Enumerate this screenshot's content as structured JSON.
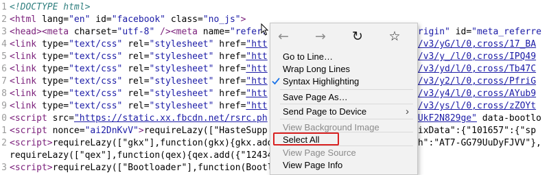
{
  "source_lines": [
    {
      "n": "1",
      "segments": [
        {
          "cls": "c",
          "text": "<!DOCTYPE html>"
        }
      ]
    },
    {
      "n": "2",
      "segments": [
        {
          "cls": "t",
          "text": "<html "
        },
        {
          "cls": "a",
          "text": "lang="
        },
        {
          "cls": "v",
          "text": "\"en\""
        },
        {
          "cls": "a",
          "text": " id="
        },
        {
          "cls": "v",
          "text": "\"facebook\""
        },
        {
          "cls": "a",
          "text": " class="
        },
        {
          "cls": "v",
          "text": "\"no_js\""
        },
        {
          "cls": "t",
          "text": ">"
        }
      ]
    },
    {
      "n": "3",
      "segments": [
        {
          "cls": "t",
          "text": "<head><meta "
        },
        {
          "cls": "a",
          "text": "charset="
        },
        {
          "cls": "v",
          "text": "\"utf-8\""
        },
        {
          "cls": "t",
          "text": " /><meta "
        },
        {
          "cls": "a",
          "text": "name="
        },
        {
          "cls": "v",
          "text": "\"referr"
        },
        {
          "cls": "plain",
          "text": "                         "
        },
        {
          "cls": "v",
          "text": "ssorigin\""
        },
        {
          "cls": "a",
          "text": " id="
        },
        {
          "cls": "v",
          "text": "\"meta_referre"
        }
      ]
    },
    {
      "n": "4",
      "segments": [
        {
          "cls": "t",
          "text": "<link "
        },
        {
          "cls": "a",
          "text": "type="
        },
        {
          "cls": "v",
          "text": "\"text/css\""
        },
        {
          "cls": "a",
          "text": " rel="
        },
        {
          "cls": "v",
          "text": "\"stylesheet\""
        },
        {
          "cls": "a",
          "text": " href="
        },
        {
          "cls": "lnk",
          "text": "\"htt"
        },
        {
          "cls": "plain",
          "text": "                         "
        },
        {
          "cls": "lnk",
          "text": "php/v3/yG/l/0,cross/17_BA"
        }
      ]
    },
    {
      "n": "5",
      "segments": [
        {
          "cls": "t",
          "text": "<link "
        },
        {
          "cls": "a",
          "text": "type="
        },
        {
          "cls": "v",
          "text": "\"text/css\""
        },
        {
          "cls": "a",
          "text": " rel="
        },
        {
          "cls": "v",
          "text": "\"stylesheet\""
        },
        {
          "cls": "a",
          "text": " href="
        },
        {
          "cls": "lnk",
          "text": "\"htt"
        },
        {
          "cls": "plain",
          "text": "                         "
        },
        {
          "cls": "lnk",
          "text": "php/v3/y_/l/0,cross/IPQ49"
        }
      ]
    },
    {
      "n": "6",
      "segments": [
        {
          "cls": "t",
          "text": "<link "
        },
        {
          "cls": "a",
          "text": "type="
        },
        {
          "cls": "v",
          "text": "\"text/css\""
        },
        {
          "cls": "a",
          "text": " rel="
        },
        {
          "cls": "v",
          "text": "\"stylesheet\""
        },
        {
          "cls": "a",
          "text": " href="
        },
        {
          "cls": "lnk",
          "text": "\"htt"
        },
        {
          "cls": "plain",
          "text": "                         "
        },
        {
          "cls": "lnk",
          "text": "php/v3/yd/l/0,cross/Tb47C"
        }
      ]
    },
    {
      "n": "7",
      "segments": [
        {
          "cls": "t",
          "text": "<link "
        },
        {
          "cls": "a",
          "text": "type="
        },
        {
          "cls": "v",
          "text": "\"text/css\""
        },
        {
          "cls": "a",
          "text": " rel="
        },
        {
          "cls": "v",
          "text": "\"stylesheet\""
        },
        {
          "cls": "a",
          "text": " href="
        },
        {
          "cls": "lnk",
          "text": "\"htt"
        },
        {
          "cls": "plain",
          "text": "                         "
        },
        {
          "cls": "lnk",
          "text": "php/v3/y2/l/0,cross/PfriG"
        }
      ]
    },
    {
      "n": "8",
      "segments": [
        {
          "cls": "t",
          "text": "<link "
        },
        {
          "cls": "a",
          "text": "type="
        },
        {
          "cls": "v",
          "text": "\"text/css\""
        },
        {
          "cls": "a",
          "text": " rel="
        },
        {
          "cls": "v",
          "text": "\"stylesheet\""
        },
        {
          "cls": "a",
          "text": " href="
        },
        {
          "cls": "lnk",
          "text": "\"htt"
        },
        {
          "cls": "plain",
          "text": "                         "
        },
        {
          "cls": "lnk",
          "text": "php/v3/y4/l/0,cross/AYub9"
        }
      ]
    },
    {
      "n": "9",
      "segments": [
        {
          "cls": "t",
          "text": "<link "
        },
        {
          "cls": "a",
          "text": "type="
        },
        {
          "cls": "v",
          "text": "\"text/css\""
        },
        {
          "cls": "a",
          "text": " rel="
        },
        {
          "cls": "v",
          "text": "\"stylesheet\""
        },
        {
          "cls": "a",
          "text": " href="
        },
        {
          "cls": "lnk",
          "text": "\"htt"
        },
        {
          "cls": "plain",
          "text": "                         "
        },
        {
          "cls": "lnk",
          "text": "php/v3/ys/l/0,cross/zZOYt"
        }
      ]
    },
    {
      "n": "0",
      "segments": [
        {
          "cls": "t",
          "text": "<script "
        },
        {
          "cls": "a",
          "text": "src="
        },
        {
          "cls": "lnk",
          "text": "\"https://static.xx.fbcdn.net/rsrc.ph"
        },
        {
          "cls": "plain",
          "text": "                         "
        },
        {
          "cls": "lnk",
          "text": "k=dUkF2N829ge\""
        },
        {
          "cls": "a",
          "text": " data-bootlo"
        }
      ]
    },
    {
      "n": "1",
      "segments": [
        {
          "cls": "t",
          "text": "<script "
        },
        {
          "cls": "a",
          "text": "nonce="
        },
        {
          "cls": "v",
          "text": "\"ai2DnKvV\""
        },
        {
          "cls": "t",
          "text": ">"
        },
        {
          "cls": "plain",
          "text": "requireLazy([\"HasteSupp                         ({\"ixData\":{\"101657\":{\"sp"
        }
      ]
    },
    {
      "n": "2",
      "segments": [
        {
          "cls": "t",
          "text": "<script>"
        },
        {
          "cls": "plain",
          "text": "requireLazy([\"gkx\"],function(gkx){gkx.add                         ash\":\"AT7-GG79UuDyFJVV\"},"
        }
      ]
    },
    {
      "n": "",
      "segments": [
        {
          "cls": "plain",
          "text": "requireLazy([\"qex\"],function(qex){qex.add({\"12434"
        }
      ]
    },
    {
      "n": "3",
      "segments": [
        {
          "cls": "t",
          "text": "<script>"
        },
        {
          "cls": "plain",
          "text": "requireLazy([\"Bootloader\"],function(Bootloader){Bo"
        }
      ]
    }
  ],
  "context_menu": {
    "nav": [
      {
        "name": "back-icon",
        "glyph": "←",
        "disabled": true
      },
      {
        "name": "forward-icon",
        "glyph": "→",
        "disabled": true
      },
      {
        "name": "reload-icon",
        "glyph": "↻",
        "disabled": false
      },
      {
        "name": "bookmark-star-icon",
        "glyph": "☆",
        "disabled": false
      }
    ],
    "items": [
      {
        "name": "menu-item-go-to-line",
        "label": "Go to Line…",
        "disabled": false,
        "checked": false,
        "submenu": false
      },
      {
        "name": "menu-item-wrap-long-lines",
        "label": "Wrap Long Lines",
        "disabled": false,
        "checked": false,
        "submenu": false
      },
      {
        "name": "menu-item-syntax-highlighting",
        "label": "Syntax Highlighting",
        "disabled": false,
        "checked": true,
        "submenu": false
      },
      {
        "name": "menu-item-save-page-as",
        "label": "Save Page As…",
        "disabled": false,
        "checked": false,
        "submenu": false
      },
      {
        "name": "menu-item-send-page-to-device",
        "label": "Send Page to Device",
        "disabled": false,
        "checked": false,
        "submenu": true
      },
      {
        "name": "menu-item-view-background-image",
        "label": "View Background Image",
        "disabled": true,
        "checked": false,
        "submenu": false
      },
      {
        "name": "menu-item-select-all",
        "label": "Select All",
        "disabled": false,
        "checked": false,
        "submenu": false
      },
      {
        "name": "menu-item-view-page-source",
        "label": "View Page Source",
        "disabled": true,
        "checked": false,
        "submenu": false
      },
      {
        "name": "menu-item-view-page-info",
        "label": "View Page Info",
        "disabled": false,
        "checked": false,
        "submenu": false
      }
    ]
  },
  "colors": {
    "highlight_box": "#d92020",
    "check": "#1a73e8"
  }
}
